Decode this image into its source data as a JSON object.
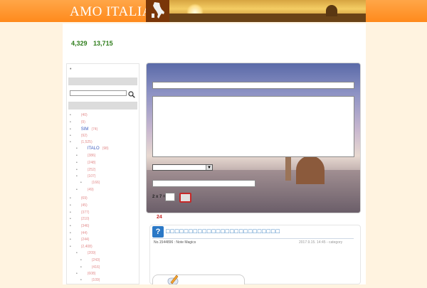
{
  "header": {
    "logo": "AMO ITALIA"
  },
  "counter": {
    "today": "4,329",
    "total": "13,715"
  },
  "sidebar": {
    "bullet": "•",
    "categories": [
      {
        "name": "",
        "count": "(40)",
        "level": 0
      },
      {
        "name": "",
        "count": "(9)",
        "level": 0
      },
      {
        "name": "SIM",
        "count": "(74)",
        "level": 0
      },
      {
        "name": "",
        "count": "(92)",
        "level": 0
      },
      {
        "name": "",
        "count": "(1,525)",
        "level": 0
      },
      {
        "name": "ITALO",
        "count": "(98)",
        "level": 1
      },
      {
        "name": "",
        "count": "(386)",
        "level": 1
      },
      {
        "name": "",
        "count": "(248)",
        "level": 1
      },
      {
        "name": "",
        "count": "(252)",
        "level": 1
      },
      {
        "name": "",
        "count": "(107)",
        "level": 1
      },
      {
        "name": "",
        "count": "(166)",
        "level": 2
      },
      {
        "name": "",
        "count": "(49)",
        "level": 1
      },
      {
        "name": "",
        "count": "(69)",
        "level": 0
      },
      {
        "name": "",
        "count": "(45)",
        "level": 0
      },
      {
        "name": "",
        "count": "(377)",
        "level": 0
      },
      {
        "name": "",
        "count": "(210)",
        "level": 0
      },
      {
        "name": "",
        "count": "(346)",
        "level": 0
      },
      {
        "name": "",
        "count": "(44)",
        "level": 0
      },
      {
        "name": "",
        "count": "(244)",
        "level": 0
      },
      {
        "name": "",
        "count": "(2,408)",
        "level": 0
      },
      {
        "name": "",
        "count": "(209)",
        "level": 1
      },
      {
        "name": "",
        "count": "(243)",
        "level": 2
      },
      {
        "name": "",
        "count": "(416)",
        "level": 2
      },
      {
        "name": "",
        "count": "(608)",
        "level": 1
      },
      {
        "name": "",
        "count": "(109)",
        "level": 2
      }
    ]
  },
  "form": {
    "captcha_label": "2 x 7 =",
    "count": "24"
  },
  "post": {
    "title": "□□□□□□□□□□□□□□□□□□□□□□□□□",
    "meta_left": "No.1544896 : Note Magics",
    "meta_right": "2017.9.15. 14:45 - category"
  },
  "colors": {
    "header": "#ff8a1c",
    "counter": "#2f7d1c",
    "accent_red": "#c62828",
    "link_blue": "#1f6fb8"
  }
}
